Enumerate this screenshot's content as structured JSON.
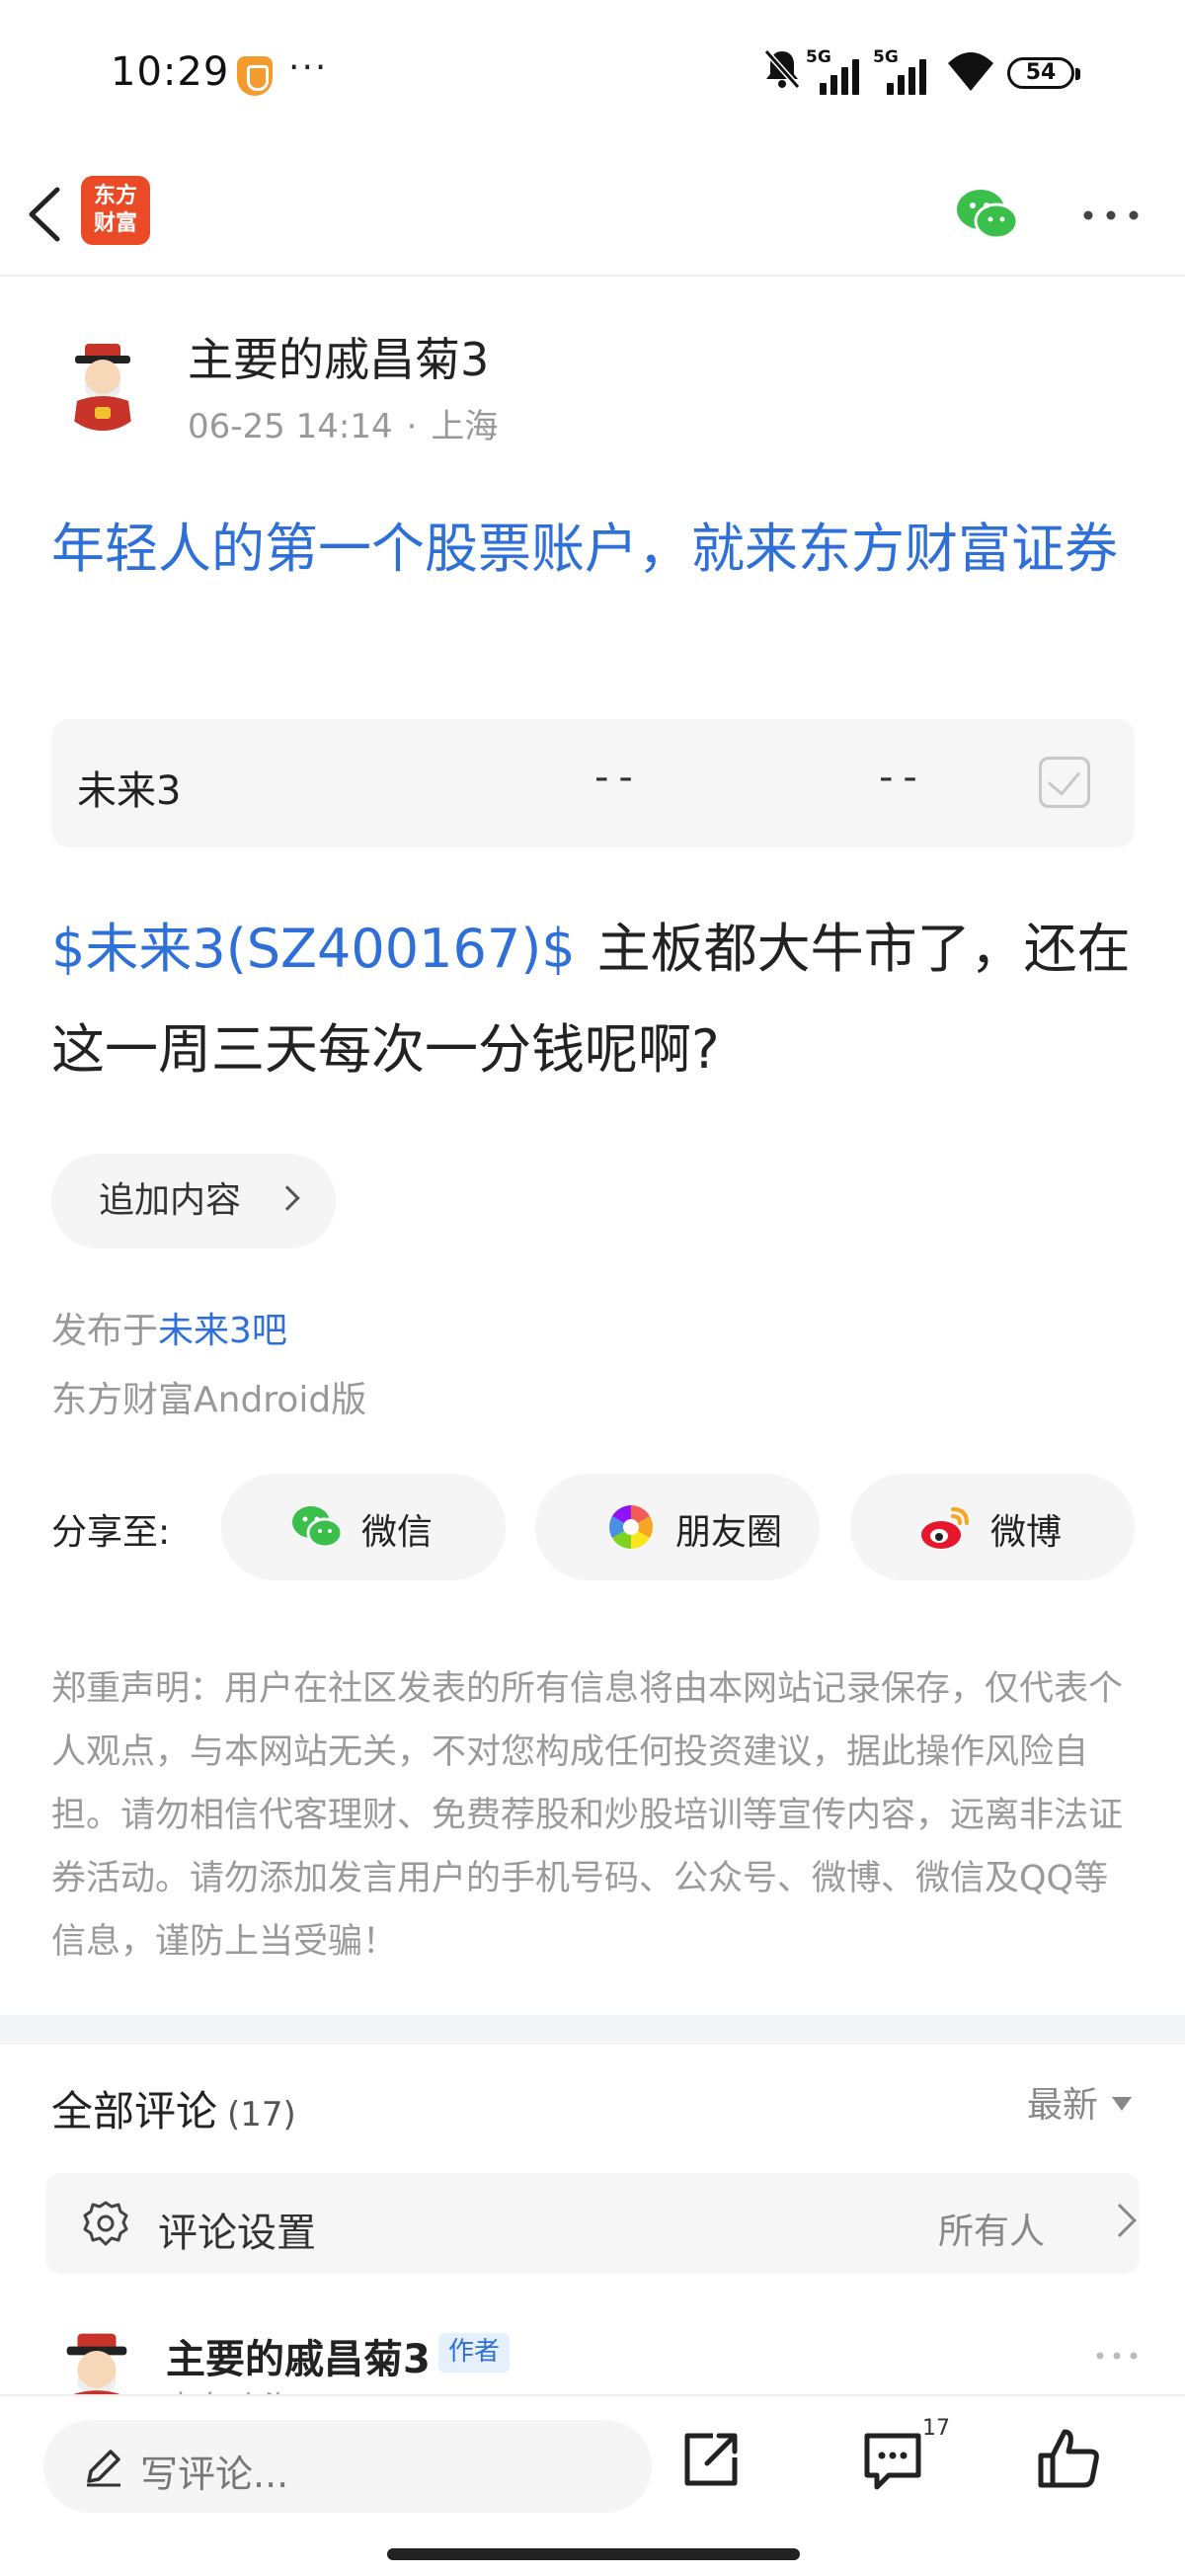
{
  "status_bar": {
    "time": "10:29",
    "signal1_label": "5G",
    "signal2_label": "5G",
    "battery": "54"
  },
  "nav": {
    "logo_line1": "东方",
    "logo_line2": "财富"
  },
  "author": {
    "name": "主要的戚昌菊3",
    "date": "06-25 14:14",
    "separator": "·",
    "location": "上海"
  },
  "ad_title": "年轻人的第一个股票账户，就来东方财富证券",
  "stock": {
    "name": "未来3",
    "value1": "--",
    "value2": "--"
  },
  "post": {
    "tag": "$未来3(SZ400167)$",
    "text": "主板都大牛市了，还在这一周三天每次一分钱呢啊?"
  },
  "append_button": "追加内容",
  "published": {
    "prefix": "发布于",
    "bar": "未来3吧"
  },
  "source": "东方财富Android版",
  "share": {
    "label": "分享至:",
    "wechat": "微信",
    "moments": "朋友圈",
    "weibo": "微博"
  },
  "disclaimer": "郑重声明：用户在社区发表的所有信息将由本网站记录保存，仅代表个人观点，与本网站无关，不对您构成任何投资建议，据此操作风险自担。请勿相信代客理财、免费荐股和炒股培训等宣传内容，远离非法证券活动。请勿添加发言用户的手机号码、公众号、微博、微信及QQ等信息，谨防上当受骗！",
  "comments": {
    "title": "全部评论",
    "count": "(17)",
    "sort": "最新",
    "settings_label": "评论设置",
    "settings_value": "所有人",
    "first": {
      "name": "主要的戚昌菊3",
      "badge": "作者",
      "sub": "来自 上海"
    }
  },
  "bottom_bar": {
    "placeholder": "写评论...",
    "comment_count": "17"
  },
  "colors": {
    "link_blue": "#2f6fd8",
    "brand_orange": "#ea4a26",
    "wechat_green": "#3bbf4b",
    "weibo_red": "#e6162d"
  }
}
